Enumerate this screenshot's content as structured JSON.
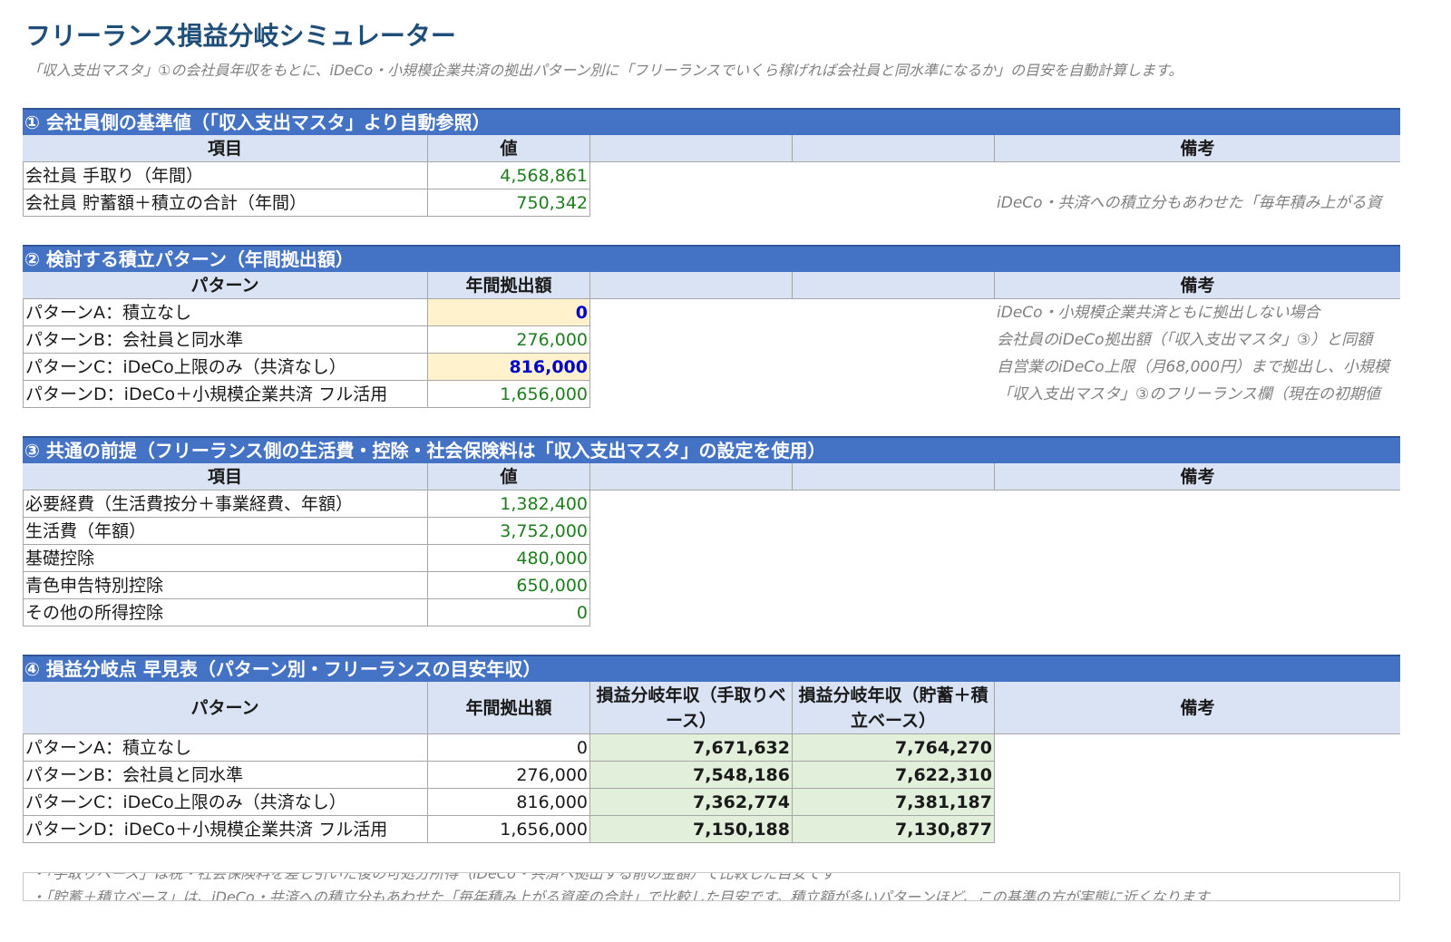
{
  "title": "フリーランス損益分岐シミュレーター",
  "subtitle": "「収入支出マスタ」①の会社員年収をもとに、iDeCo・小規模企業共済の拠出パターン別に「フリーランスでいくら稼げれば会社員と同水準になるか」の目安を自動計算します。",
  "s1": {
    "title": "① 会社員側の基準値（「収入支出マスタ」より自動参照）",
    "headers": [
      "項目",
      "値",
      "",
      "",
      "備考"
    ],
    "rows": [
      {
        "label": "会社員 手取り（年間）",
        "value": "4,568,861",
        "note": ""
      },
      {
        "label": "会社員 貯蓄額＋積立の合計（年間）",
        "value": "750,342",
        "note": "iDeCo・共済への積立分もあわせた「毎年積み上がる資"
      }
    ]
  },
  "s2": {
    "title": "② 検討する積立パターン（年間拠出額）",
    "headers": [
      "パターン",
      "年間拠出額",
      "",
      "",
      "備考"
    ],
    "rows": [
      {
        "label": "パターンA：積立なし",
        "value": "0",
        "note": "iDeCo・小規模企業共済ともに拠出しない場合"
      },
      {
        "label": "パターンB：会社員と同水準",
        "value": "276,000",
        "note": "会社員のiDeCo拠出額（「収入支出マスタ」③）と同額"
      },
      {
        "label": "パターンC：iDeCo上限のみ（共済なし）",
        "value": "816,000",
        "note": "自営業のiDeCo上限（月68,000円）まで拠出し、小規模"
      },
      {
        "label": "パターンD：iDeCo＋小規模企業共済 フル活用",
        "value": "1,656,000",
        "note": "「収入支出マスタ」③のフリーランス欄（現在の初期値"
      }
    ]
  },
  "s3": {
    "title": "③ 共通の前提（フリーランス側の生活費・控除・社会保険料は「収入支出マスタ」の設定を使用）",
    "headers": [
      "項目",
      "値",
      "",
      "",
      "備考"
    ],
    "rows": [
      {
        "label": "必要経費（生活費按分＋事業経費、年額）",
        "value": "1,382,400"
      },
      {
        "label": "生活費（年額）",
        "value": "3,752,000"
      },
      {
        "label": "基礎控除",
        "value": "480,000"
      },
      {
        "label": "青色申告特別控除",
        "value": "650,000"
      },
      {
        "label": "その他の所得控除",
        "value": "0"
      }
    ]
  },
  "s4": {
    "title": "④ 損益分岐点 早見表（パターン別・フリーランスの目安年収）",
    "headers": [
      "パターン",
      "年間拠出額",
      "損益分岐年収（手取りベース）",
      "損益分岐年収（貯蓄＋積立ベース）",
      "備考"
    ],
    "rows": [
      {
        "label": "パターンA：積立なし",
        "contrib": "0",
        "takehome": "7,671,632",
        "savings": "7,764,270"
      },
      {
        "label": "パターンB：会社員と同水準",
        "contrib": "276,000",
        "takehome": "7,548,186",
        "savings": "7,622,310"
      },
      {
        "label": "パターンC：iDeCo上限のみ（共済なし）",
        "contrib": "816,000",
        "takehome": "7,362,774",
        "savings": "7,381,187"
      },
      {
        "label": "パターンD：iDeCo＋小規模企業共済 フル活用",
        "contrib": "1,656,000",
        "takehome": "7,150,188",
        "savings": "7,130,877"
      }
    ]
  },
  "footnotes": [
    "・「手取りベース」は税・社会保険料を差し引いた後の可処分所得（iDeCo・共済へ拠出する前の金額）で比較した目安です",
    "・「貯蓄＋積立ベース」は、iDeCo・共済への積立分もあわせた「毎年積み上がる資産の合計」で比較した目安です。積立額が多いパターンほど、この基準の方が実態に近くなります"
  ]
}
